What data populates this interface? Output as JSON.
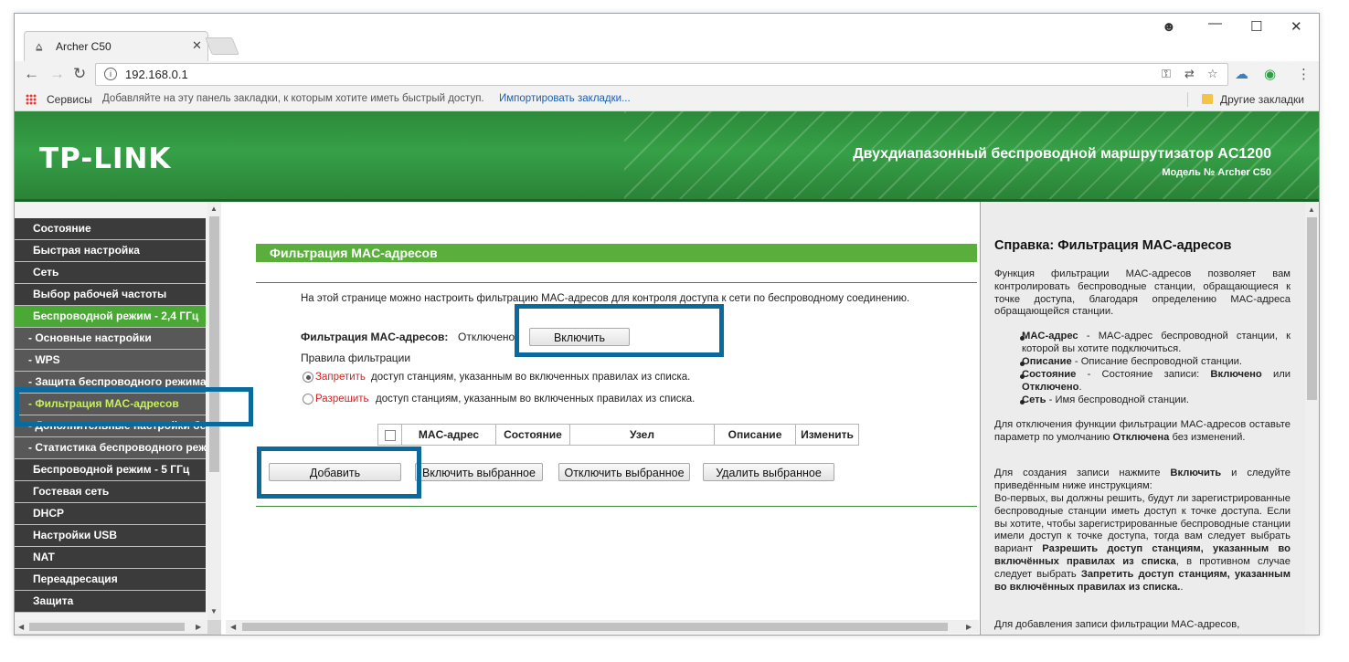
{
  "browser": {
    "tab_title": "Archer C50",
    "url": "192.168.0.1",
    "bookmarks": {
      "apps_label": "Сервисы",
      "hint": "Добавляйте на эту панель закладки, к которым хотите иметь быстрый доступ.",
      "import_link": "Импортировать закладки...",
      "other": "Другие закладки"
    }
  },
  "header": {
    "logo": "TP-LINK",
    "title": "Двухдиапазонный беспроводной маршрутизатор AC1200",
    "model": "Модель № Archer C50"
  },
  "menu": [
    {
      "label": "Состояние",
      "kind": "main"
    },
    {
      "label": "Быстрая настройка",
      "kind": "main"
    },
    {
      "label": "Сеть",
      "kind": "main"
    },
    {
      "label": "Выбор рабочей частоты",
      "kind": "main"
    },
    {
      "label": "Беспроводной режим - 2,4 ГГц",
      "kind": "active"
    },
    {
      "label": "- Основные настройки",
      "kind": "sub"
    },
    {
      "label": "- WPS",
      "kind": "sub"
    },
    {
      "label": "- Защита беспроводного режима",
      "kind": "sub"
    },
    {
      "label": "- Фильтрация MAC-адресов",
      "kind": "sub-active"
    },
    {
      "label": "- Дополнительные настройки беспроводного режима",
      "kind": "sub"
    },
    {
      "label": "- Статистика беспроводного режима",
      "kind": "sub"
    },
    {
      "label": "Беспроводной режим - 5 ГГц",
      "kind": "main"
    },
    {
      "label": "Гостевая сеть",
      "kind": "main"
    },
    {
      "label": "DHCP",
      "kind": "main"
    },
    {
      "label": "Настройки USB",
      "kind": "main"
    },
    {
      "label": "NAT",
      "kind": "main"
    },
    {
      "label": "Переадресация",
      "kind": "main"
    },
    {
      "label": "Защита",
      "kind": "main"
    }
  ],
  "main": {
    "section_title": "Фильтрация MAC-адресов",
    "description": "На этой странице можно настроить фильтрацию MAC-адресов для контроля доступа к сети по беспроводному соединению.",
    "filter_label": "Фильтрация MAC-адресов:",
    "filter_status": "Отключено",
    "enable_button": "Включить",
    "rules_label": "Правила фильтрации",
    "rule_deny_word": "Запретить",
    "rule_deny_text": "доступ станциям, указанным во включенных правилах из списка.",
    "rule_allow_word": "Разрешить",
    "rule_allow_text": "доступ станциям, указанным во включенных правилах из списка.",
    "table_headers": [
      "MAC-адрес",
      "Состояние",
      "Узел",
      "Описание",
      "Изменить"
    ],
    "buttons": {
      "add": "Добавить",
      "enable_selected": "Включить выбранное",
      "disable_selected": "Отключить выбранное",
      "delete_selected": "Удалить выбранное"
    }
  },
  "help": {
    "title": "Справка: Фильтрация MAC-адресов",
    "intro": "Функция фильтрации MAC-адресов позволяет вам контролировать беспроводные станции, обращающиеся к точке доступа, благодаря определению MAC-адреса обращающейся станции.",
    "items": [
      {
        "term": "MAC-адрес",
        "text": " - MAC-адрес беспроводной станции, к которой вы хотите подключиться."
      },
      {
        "term": "Описание",
        "text": " - Описание беспроводной станции."
      },
      {
        "term": "Состояние",
        "text": " - Состояние записи: ",
        "b1": "Включено",
        "mid": " или ",
        "b2": "Отключено",
        "end": "."
      },
      {
        "term": "Сеть",
        "text": " - Имя беспроводной станции."
      }
    ],
    "p2_start": "Для отключения функции фильтрации MAC-адресов оставьте параметр по умолчанию ",
    "p2_bold": "Отключена",
    "p2_end": " без изменений.",
    "p3_start": "Для создания записи нажмите ",
    "p3_bold": "Включить",
    "p3_end": " и следуйте приведённым ниже инструкциям:",
    "p4_start": "Во-первых, вы должны решить, будут ли зарегистрированные беспроводные станции иметь доступ к точке доступа. Если вы хотите, чтобы зарегистрированные беспроводные станции имели доступ к точке доступа, тогда вам следует выбрать вариант ",
    "p4_bold1": "Разрешить доступ станциям, указанным во включённых правилах из списка",
    "p4_mid": ", в противном случае следует выбрать ",
    "p4_bold2": "Запретить доступ станциям, указанным во включённых правилах из списка.",
    "p4_end": ".",
    "p5": "Для добавления записи фильтрации MAC-адресов,"
  },
  "colors": {
    "brand_green": "#36a047",
    "menu_active": "#4aa834",
    "highlight_blue": "#0a6a9e"
  }
}
